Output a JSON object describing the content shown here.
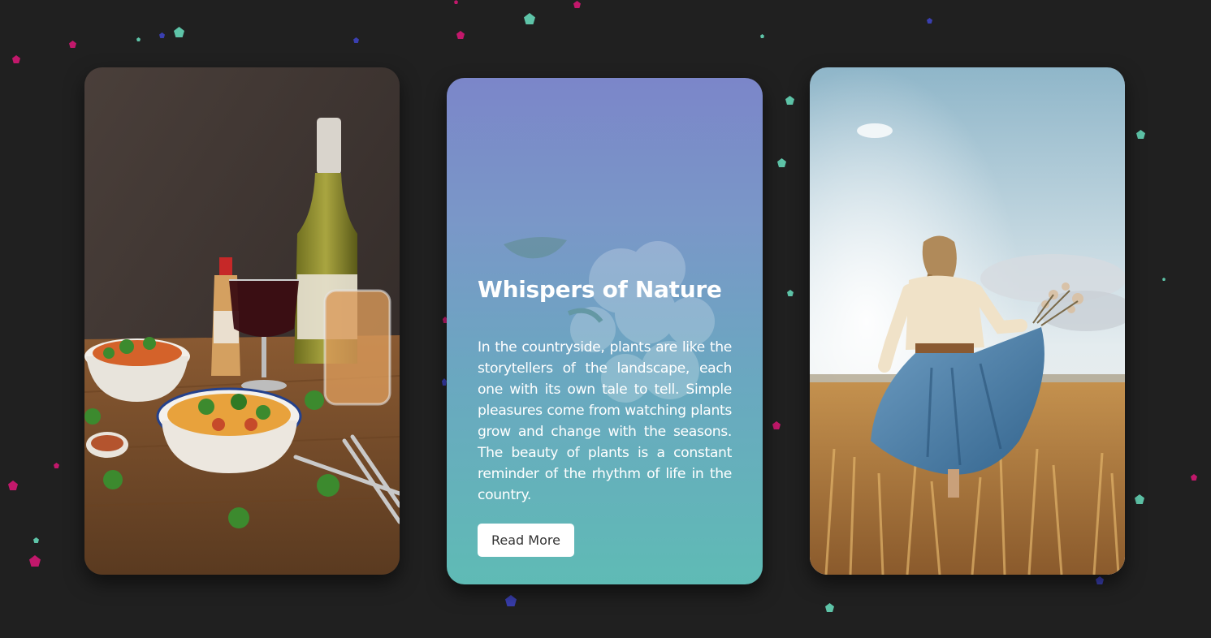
{
  "cards": [
    {
      "image_subject": "food and wine on wooden table"
    },
    {
      "title": "Whispers of Nature",
      "text": "In the countryside, plants are like the storytellers of the landscape, each one with its own tale to tell. Simple pleasures come from watching plants grow and change with the seasons. The beauty of plants is a constant reminder of the rhythm of life in the country.",
      "button_label": "Read More",
      "gradient": [
        "#7b86c9",
        "#5fbbb5"
      ]
    },
    {
      "image_subject": "woman in blue skirt in wheat field"
    }
  ],
  "colors": {
    "background": "#202020",
    "confetti": [
      "#5ec4a8",
      "#c2186b",
      "#3a3fb0"
    ]
  }
}
